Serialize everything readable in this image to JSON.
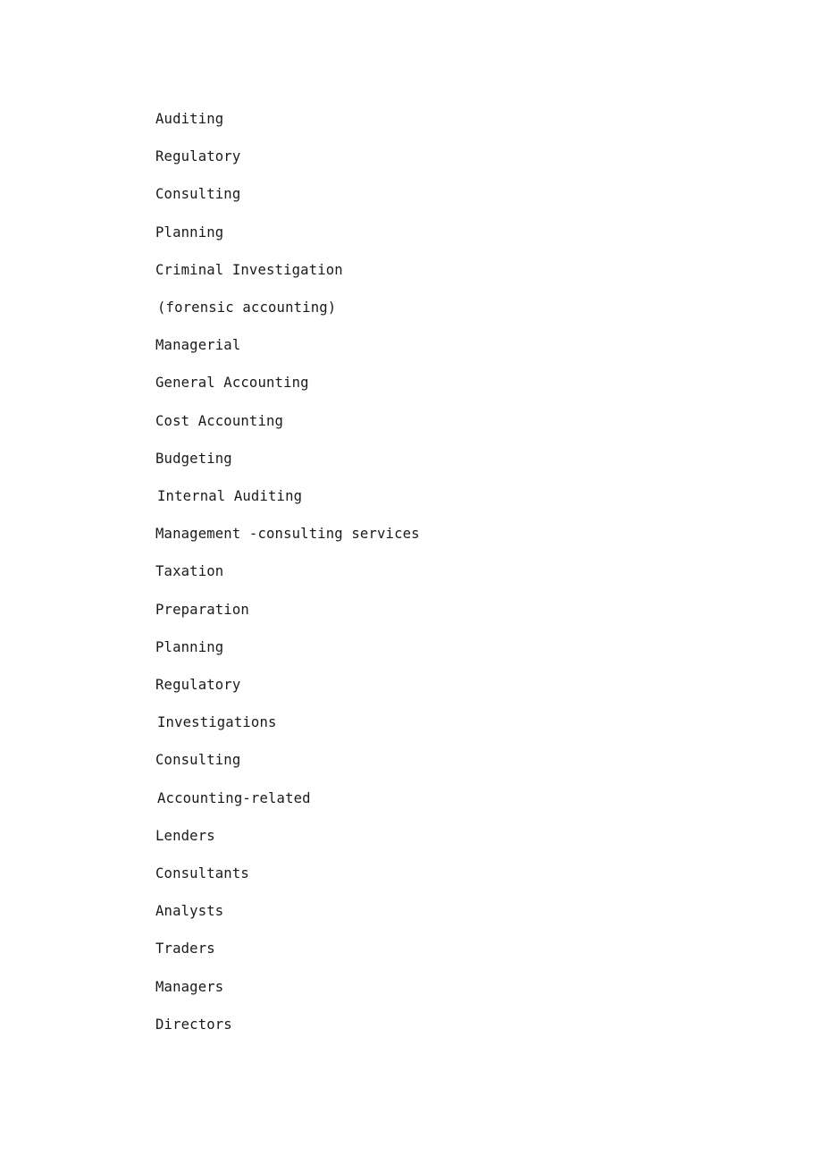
{
  "document": {
    "background_color": "#ffffff",
    "text_color": "#1a1a1a",
    "lines": [
      {
        "text": "Auditing",
        "indent": 0
      },
      {
        "text": "Regulatory",
        "indent": 0
      },
      {
        "text": "Consulting",
        "indent": 0
      },
      {
        "text": "Planning",
        "indent": 0
      },
      {
        "text": "Criminal Investigation",
        "indent": 0
      },
      {
        "text": "(forensic accounting)",
        "indent": 1
      },
      {
        "text": "Managerial",
        "indent": 0
      },
      {
        "text": "General Accounting",
        "indent": 0
      },
      {
        "text": "Cost Accounting",
        "indent": 0
      },
      {
        "text": "Budgeting",
        "indent": 0
      },
      {
        "text": "Internal Auditing",
        "indent": 1
      },
      {
        "text": "Management -consulting services",
        "indent": 0
      },
      {
        "text": "Taxation",
        "indent": 0
      },
      {
        "text": "Preparation",
        "indent": 0
      },
      {
        "text": "Planning",
        "indent": 0
      },
      {
        "text": "Regulatory",
        "indent": 0
      },
      {
        "text": "Investigations",
        "indent": 1
      },
      {
        "text": "Consulting",
        "indent": 0
      },
      {
        "text": "Accounting-related",
        "indent": 1
      },
      {
        "text": "Lenders",
        "indent": 0
      },
      {
        "text": "Consultants",
        "indent": 0
      },
      {
        "text": "Analysts",
        "indent": 0
      },
      {
        "text": "Traders",
        "indent": 0
      },
      {
        "text": "Managers",
        "indent": 0
      },
      {
        "text": "Directors",
        "indent": 0
      }
    ]
  }
}
